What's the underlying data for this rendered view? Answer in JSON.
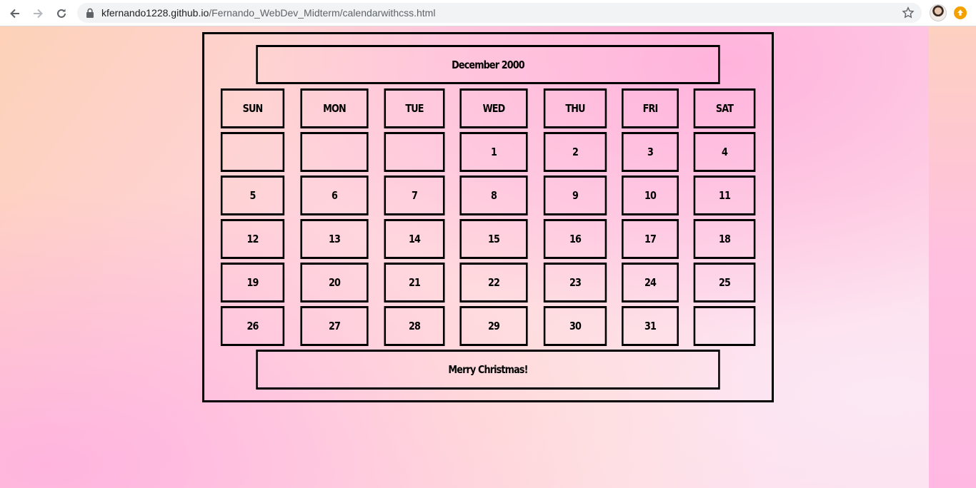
{
  "browser": {
    "url_host": "kfernando1228.github.io",
    "url_path": "/Fernando_WebDev_Midterm/calendarwithcss.html",
    "icons": {
      "back": "arrow-left-icon",
      "forward": "arrow-right-icon",
      "reload": "reload-icon",
      "lock": "lock-icon",
      "bookmark": "star-icon"
    }
  },
  "calendar": {
    "title": "December 2000",
    "days": [
      "SUN",
      "MON",
      "TUE",
      "WED",
      "THU",
      "FRI",
      "SAT"
    ],
    "weeks": [
      [
        "",
        "",
        "",
        "1",
        "2",
        "3",
        "4"
      ],
      [
        "5",
        "6",
        "7",
        "8",
        "9",
        "10",
        "11"
      ],
      [
        "12",
        "13",
        "14",
        "15",
        "16",
        "17",
        "18"
      ],
      [
        "19",
        "20",
        "21",
        "22",
        "23",
        "24",
        "25"
      ],
      [
        "26",
        "27",
        "28",
        "29",
        "30",
        "31",
        ""
      ]
    ],
    "footer": "Merry Christmas!"
  },
  "colors": {
    "border": "#000000",
    "extension_accent": "#f4a100"
  }
}
